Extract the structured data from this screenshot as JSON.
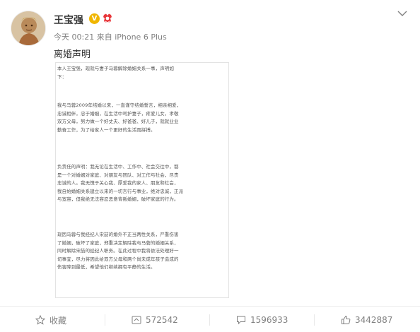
{
  "post": {
    "username": "王宝强",
    "verified_badge": "V",
    "timestamp": "今天 00:21",
    "source": "来自 iPhone 6 Plus",
    "title": "离婚声明",
    "document": {
      "paragraphs": [
        "本人王宝强，现就与妻子马蓉解除婚姻关系一事，声明如\n下：",
        "我与马蓉2009年结婚以来，一直谨守结婚誓言，相亲相爱，\n忠诚相伴，忠于婚姻，在生活中呵护妻子，疼爱儿女，孝敬\n双方父母，努力做一个好丈夫、好爸爸、好儿子，就就业业\n勤奋工作，为了给家人一个更好的生活而拼搏。",
        "负责任的声明：我无论在生活中、工作中、社会交往中，都\n是一个对婚姻对家庭、对朋友与团队、对工作与社会，尽责\n忠诚的人。我无愧于关心我、厚爱我的家人、朋友和社会，\n我自始婚姻关系建立以来的一切言行与事业，绝对忠诚，正派\n与宽容，但我绝无法容忍恶意背叛婚姻，破坏家庭的行为。",
        "现因马蓉与我经纪人宋喆的婚外不正当两性关系，严重伤害\n了婚姻，破坏了家庭，郑重决定解除我与马蓉的婚姻关系，\n同时解除宋喆的经纪人职务。在此过程中我将依法处理好一\n切事宜，尽力将因此给双方父母和两个尚未成年孩子造成的\n伤害降到最低，希望他们继续拥有平静的生活。"
      ]
    }
  },
  "actions": {
    "favorite_label": "收藏",
    "repost_count": "572542",
    "comment_count": "1596933",
    "like_count": "3442887"
  },
  "icons": {
    "verified": "verified-v-icon",
    "member": "vip-member-icon",
    "more": "chevron-down-icon",
    "favorite": "star-icon",
    "repost": "repost-icon",
    "comment": "comment-icon",
    "like": "thumbs-up-icon"
  },
  "colors": {
    "verified": "#f0b600",
    "member": "#e8373b",
    "meta_text": "#808080"
  }
}
